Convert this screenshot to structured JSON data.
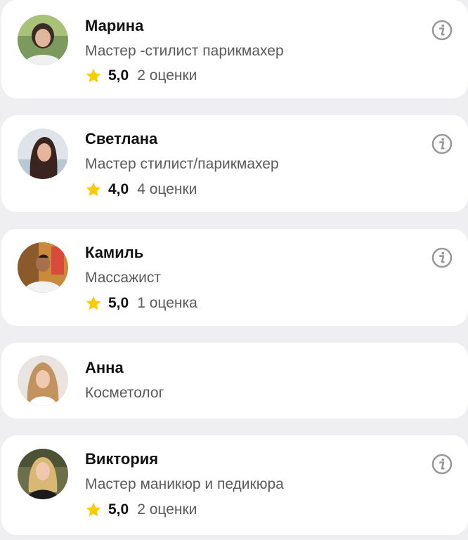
{
  "specialists": [
    {
      "name": "Марина",
      "role": "Мастер -стилист парикмахер",
      "score": "5,0",
      "reviews": "2 оценки",
      "has_rating": true,
      "has_info": true
    },
    {
      "name": "Светлана",
      "role": "Мастер стилист/парикмахер",
      "score": "4,0",
      "reviews": "4 оценки",
      "has_rating": true,
      "has_info": true
    },
    {
      "name": "Камиль",
      "role": "Массажист",
      "score": "5,0",
      "reviews": "1 оценка",
      "has_rating": true,
      "has_info": true
    },
    {
      "name": "Анна",
      "role": "Косметолог",
      "has_rating": false,
      "has_info": false
    },
    {
      "name": "Виктория",
      "role": "Мастер маникюр и педикюра",
      "score": "5,0",
      "reviews": "2 оценки",
      "has_rating": true,
      "has_info": true
    }
  ],
  "colors": {
    "star": "#fccc00",
    "info_icon": "#9a9a9a",
    "background": "#efeff1",
    "card": "#ffffff"
  },
  "icons": {
    "rating": "star-icon",
    "info": "info-icon"
  }
}
